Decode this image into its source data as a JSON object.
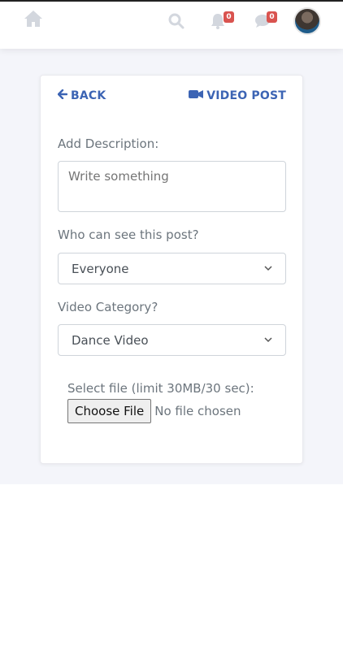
{
  "topbar": {
    "home_icon": "home-icon",
    "search_icon": "search-icon",
    "notifications": {
      "icon": "bell-icon",
      "count": "0"
    },
    "messages": {
      "icon": "chat-icon",
      "count": "0"
    },
    "avatar": "avatar"
  },
  "card": {
    "back_label": "BACK",
    "title": "VIDEO POST",
    "description_label": "Add Description:",
    "description_placeholder": "Write something",
    "visibility_label": "Who can see this post?",
    "visibility_value": "Everyone",
    "category_label": "Video Category?",
    "category_value": "Dance Video",
    "file_label": "Select file (limit 30MB/30 sec):",
    "choose_file": "Choose File",
    "no_file": "No file chosen"
  },
  "colors": {
    "accent": "#3c64b4",
    "badge": "#d9534f",
    "muted": "#6c757d"
  }
}
